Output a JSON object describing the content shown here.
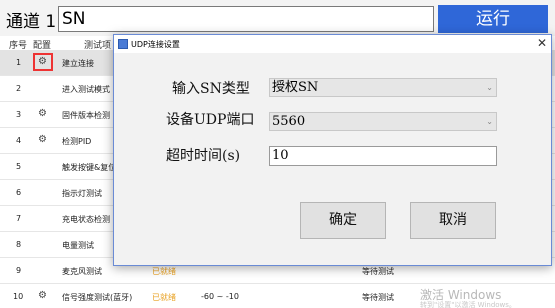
{
  "header": {
    "channel_label": "通道 1",
    "sn_value": "SN",
    "run_label": "运行"
  },
  "table": {
    "columns": {
      "index": "序号",
      "config": "配置",
      "test_item": "测试项"
    },
    "rows": [
      {
        "index": "1",
        "has_gear": true,
        "name": "建立连接",
        "status": "",
        "value": "",
        "result": "",
        "selected": true
      },
      {
        "index": "2",
        "has_gear": false,
        "name": "进入测试模式",
        "status": "",
        "value": "",
        "result": ""
      },
      {
        "index": "3",
        "has_gear": true,
        "name": "固件版本检测",
        "status": "",
        "value": "",
        "result": ""
      },
      {
        "index": "4",
        "has_gear": true,
        "name": "检测PID",
        "status": "",
        "value": "",
        "result": ""
      },
      {
        "index": "5",
        "has_gear": false,
        "name": "触发按键&复位",
        "status": "",
        "value": "",
        "result": ""
      },
      {
        "index": "6",
        "has_gear": false,
        "name": "指示灯测试",
        "status": "",
        "value": "",
        "result": ""
      },
      {
        "index": "7",
        "has_gear": false,
        "name": "充电状态检测",
        "status": "",
        "value": "",
        "result": ""
      },
      {
        "index": "8",
        "has_gear": false,
        "name": "电量测试",
        "status": "",
        "value": "",
        "result": ""
      },
      {
        "index": "9",
        "has_gear": false,
        "name": "麦克风测试",
        "status": "已就绪",
        "value": "",
        "result": "等待测试"
      },
      {
        "index": "10",
        "has_gear": true,
        "name": "信号强度测试(蓝牙)",
        "status": "已就绪",
        "value": "-60 ~ -10",
        "result": "等待测试"
      }
    ]
  },
  "dialog": {
    "title": "UDP连接设置",
    "close_glyph": "✕",
    "sn_type_label": "输入SN类型",
    "sn_type_value": "授权SN",
    "udp_port_label": "设备UDP端口",
    "udp_port_value": "5560",
    "timeout_label": "超时时间(s)",
    "timeout_value": "10",
    "ok_label": "确定",
    "cancel_label": "取消"
  },
  "watermark": {
    "line1": "激活 Windows",
    "line2": "转到\"设置\"以激活 Windows。"
  },
  "icons": {
    "gear": "gear-icon",
    "chevron": "chevron-down-icon",
    "close": "close-icon"
  }
}
